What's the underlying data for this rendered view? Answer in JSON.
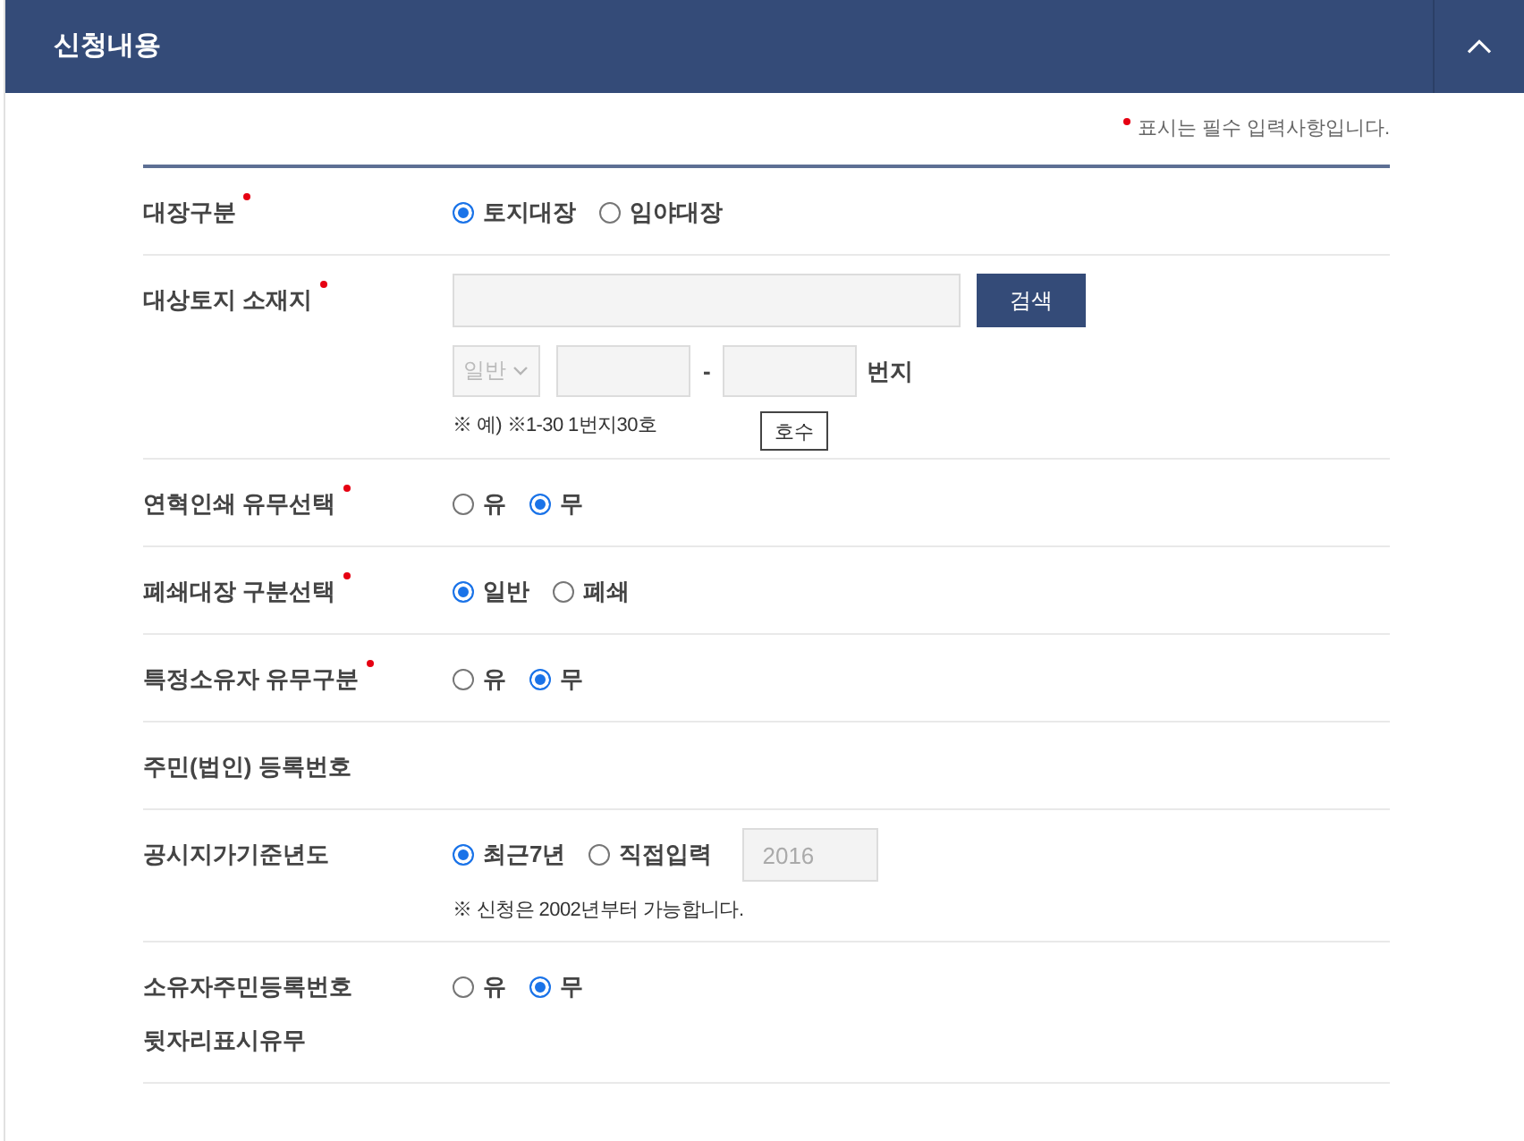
{
  "header": {
    "title": "신청내용",
    "expanded": true
  },
  "required_note": "표시는 필수 입력사항입니다.",
  "rows": [
    {
      "label": "대장구분",
      "required": true,
      "kind": "radio",
      "options": [
        {
          "label": "토지대장",
          "selected": true
        },
        {
          "label": "임야대장",
          "selected": false
        }
      ]
    },
    {
      "label": "대상토지 소재지",
      "required": true,
      "kind": "address",
      "search_button": "검색",
      "lot_type": {
        "value": "일반",
        "disabled": true
      },
      "separator": "-",
      "unit": "번지",
      "example": "※ 예) ※1-30 1번지30호",
      "sub_button": "호수"
    },
    {
      "label": "연혁인쇄 유무선택",
      "required": true,
      "kind": "radio",
      "options": [
        {
          "label": "유",
          "selected": false
        },
        {
          "label": "무",
          "selected": true
        }
      ]
    },
    {
      "label": "폐쇄대장 구분선택",
      "required": true,
      "kind": "radio",
      "options": [
        {
          "label": "일반",
          "selected": true
        },
        {
          "label": "폐쇄",
          "selected": false
        }
      ]
    },
    {
      "label": "특정소유자 유무구분",
      "required": true,
      "kind": "radio",
      "options": [
        {
          "label": "유",
          "selected": false
        },
        {
          "label": "무",
          "selected": true
        }
      ]
    },
    {
      "label": "주민(법인) 등록번호",
      "required": false,
      "kind": "empty"
    },
    {
      "label": "공시지가기준년도",
      "required": false,
      "kind": "radio",
      "options": [
        {
          "label": "최근7년",
          "selected": true
        },
        {
          "label": "직접입력",
          "selected": false
        }
      ],
      "year_field": {
        "value": "2016",
        "disabled": true
      },
      "note": "※ 신청은 2002년부터 가능합니다."
    },
    {
      "label": "소유자주민등록번호 뒷자리표시유무",
      "required": false,
      "kind": "radio",
      "options": [
        {
          "label": "유",
          "selected": false
        },
        {
          "label": "무",
          "selected": true
        }
      ]
    }
  ]
}
